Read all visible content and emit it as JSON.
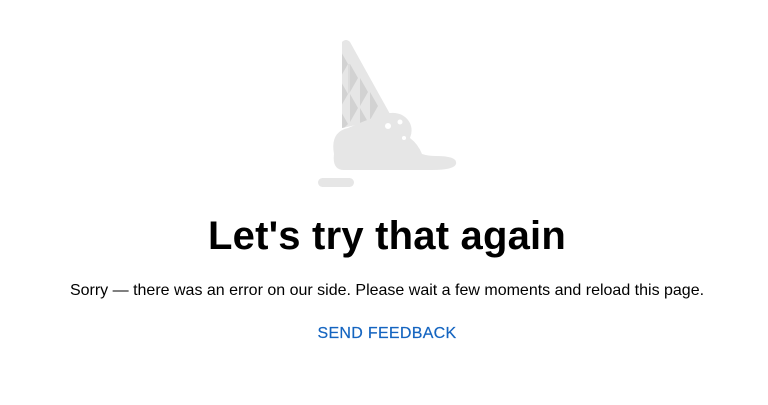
{
  "error": {
    "title": "Let's try that again",
    "message": "Sorry — there was an error on our side. Please wait a few moments and reload this page.",
    "feedback_label": "SEND FEEDBACK"
  },
  "illustration": {
    "icon": "melted-ice-cream-cone-icon"
  },
  "colors": {
    "link": "#1565c0",
    "illustration_light": "#e8e8e8",
    "illustration_dark": "#d4d4d4"
  }
}
